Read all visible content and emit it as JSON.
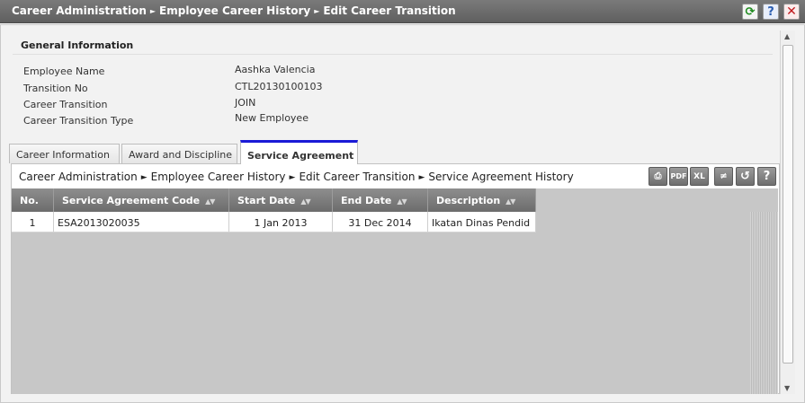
{
  "window": {
    "breadcrumb": [
      "Career Administration",
      "Employee Career History",
      "Edit Career Transition"
    ],
    "breadcrumb_separator": "►",
    "refresh_icon": "refresh-icon",
    "help_icon": "help-icon",
    "close_icon": "close-icon",
    "help_glyph": "?",
    "close_glyph": "✕",
    "refresh_glyph": "⟳"
  },
  "general_info": {
    "title": "General Information",
    "fields": [
      {
        "label": "Employee Name",
        "value": "Aashka Valencia"
      },
      {
        "label": "Transition No",
        "value": "CTL20130100103"
      },
      {
        "label": "Career Transition",
        "value": "JOIN"
      },
      {
        "label": "Career Transition Type",
        "value": "New Employee"
      }
    ]
  },
  "tabs": [
    {
      "label": "Career Information",
      "active": false
    },
    {
      "label": "Award and Discipline",
      "active": false
    },
    {
      "label": "Service Agreement",
      "active": true
    }
  ],
  "panel": {
    "breadcrumb": [
      "Career Administration",
      "Employee Career History",
      "Edit Career Transition",
      "Service Agreement History"
    ],
    "breadcrumb_separator": "►",
    "toolbar": [
      {
        "name": "print-icon",
        "glyph": "⎙"
      },
      {
        "name": "pdf-icon",
        "glyph": "PDF"
      },
      {
        "name": "excel-icon",
        "glyph": "XL"
      },
      {
        "name": "filter-icon",
        "glyph": "≠"
      },
      {
        "name": "reset-icon",
        "glyph": "↺"
      },
      {
        "name": "help-icon",
        "glyph": "?"
      }
    ]
  },
  "table": {
    "sort_glyph": "▲▼",
    "columns": [
      "No.",
      "Service Agreement Code",
      "Start Date",
      "End Date",
      "Description"
    ],
    "rows": [
      [
        "1",
        "ESA2013020035",
        "1 Jan 2013",
        "31 Dec 2014",
        "Ikatan Dinas Pendid"
      ]
    ]
  },
  "colors": {
    "active_tab_accent": "#1a1ad6",
    "header_bg": "#6c6c6c",
    "refresh": "#1e8a1e",
    "help": "#2a5db0",
    "close": "#c0161b"
  }
}
